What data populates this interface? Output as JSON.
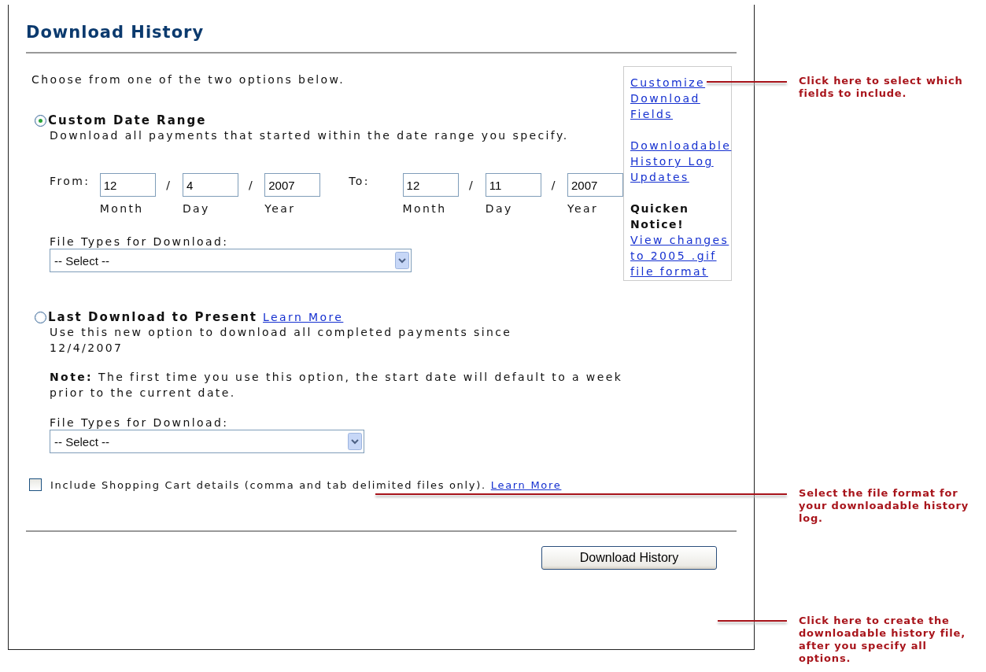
{
  "title": "Download History",
  "intro": "Choose from one of the two options below.",
  "options": [
    {
      "kind": "date_range",
      "selected": true,
      "label": "Custom Date Range",
      "description": "Download all payments that started within the date range you specify.",
      "from_label": "From:",
      "to_label": "To:",
      "separator": "/",
      "from": [
        {
          "value": "12",
          "caption": "Month"
        },
        {
          "value": "4",
          "caption": "Day"
        },
        {
          "value": "2007",
          "caption": "Year"
        }
      ],
      "to": [
        {
          "value": "12",
          "caption": "Month"
        },
        {
          "value": "11",
          "caption": "Day"
        },
        {
          "value": "2007",
          "caption": "Year"
        }
      ],
      "file_type_label": "File Types for Download:",
      "select_value": "-- Select --"
    },
    {
      "kind": "last_download",
      "selected": false,
      "label": "Last Download to Present",
      "link": "Learn More",
      "description": "Use this new option to download all completed payments since 12/4/2007",
      "note": "**Note:** The first time you use this option, the start date will default to a week prior to the current date.",
      "file_type_label": "File Types for Download:",
      "select_value": "-- Select --"
    }
  ],
  "checkbox": {
    "checked": false,
    "label": "Include Shopping Cart details (comma and tab delimited files only).",
    "link": "Learn More"
  },
  "button": "Download History",
  "sidebar": [
    {
      "kind": "link",
      "text": "Customize Download Fields"
    },
    {
      "kind": "link",
      "text": "Downloadable History Log Updates"
    },
    {
      "kind": "heading",
      "text": "Quicken Notice!"
    },
    {
      "kind": "link",
      "text": "View changes to 2005 .gif file format"
    }
  ],
  "callouts": [
    {
      "text": "Click here to select which fields to include."
    },
    {
      "text": "Select the file format for your downloadable history log."
    },
    {
      "text": "Click here to create the downloadable history file, after you specify all options."
    }
  ]
}
